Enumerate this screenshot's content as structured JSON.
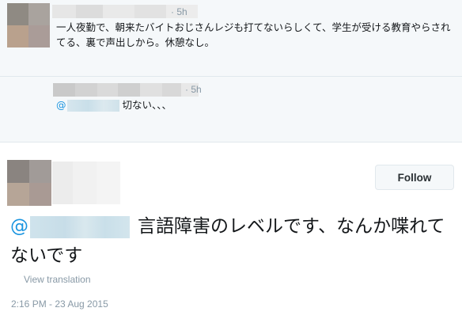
{
  "replies": [
    {
      "time": "5h",
      "text": "一人夜勤で、朝来たバイトおじさんレジも打てないらしくて、学生が受ける教育やらされてる、裏で声出しから。休憩なし。"
    },
    {
      "time": "5h",
      "at": "@",
      "text": "切ない、、、"
    }
  ],
  "main_tweet": {
    "follow_label": "Follow",
    "at": "@",
    "text": "言語障害のレベルです、なんか喋れてないです",
    "translate_label": "View translation",
    "timestamp": "2:16 PM - 23 Aug 2015"
  }
}
